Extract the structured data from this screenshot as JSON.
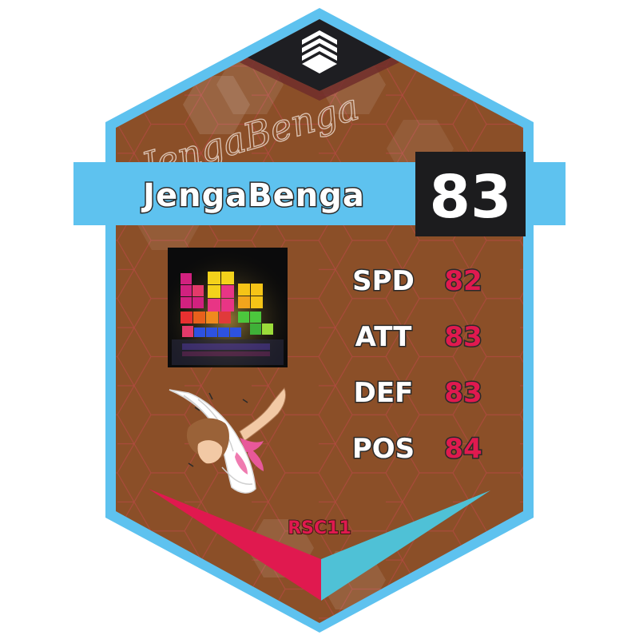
{
  "card": {
    "player_name": "JengaBenga",
    "signature": "JengaBenga",
    "overall_rating": "83",
    "team_tag": "RSC11",
    "stats": [
      {
        "label": "SPD",
        "value": "82"
      },
      {
        "label": "ATT",
        "value": "83"
      },
      {
        "label": "DEF",
        "value": "83"
      },
      {
        "label": "POS",
        "value": "84"
      }
    ]
  },
  "colors": {
    "frame_blue": "#5ec2ef",
    "card_brown": "#8b4f28",
    "hex_line": "#c0474a",
    "top_dark": "#1e1e22",
    "rating_box": "#1c1c1e",
    "stat_value": "#e0194f",
    "chevron_pink": "#e0194f",
    "chevron_teal": "#4fc1d6"
  },
  "icons": {
    "brand_logo": "stacked-chevrons-logo",
    "player_avatar": "tetris-blocks-image",
    "mascot": "winged-figure-illustration"
  }
}
